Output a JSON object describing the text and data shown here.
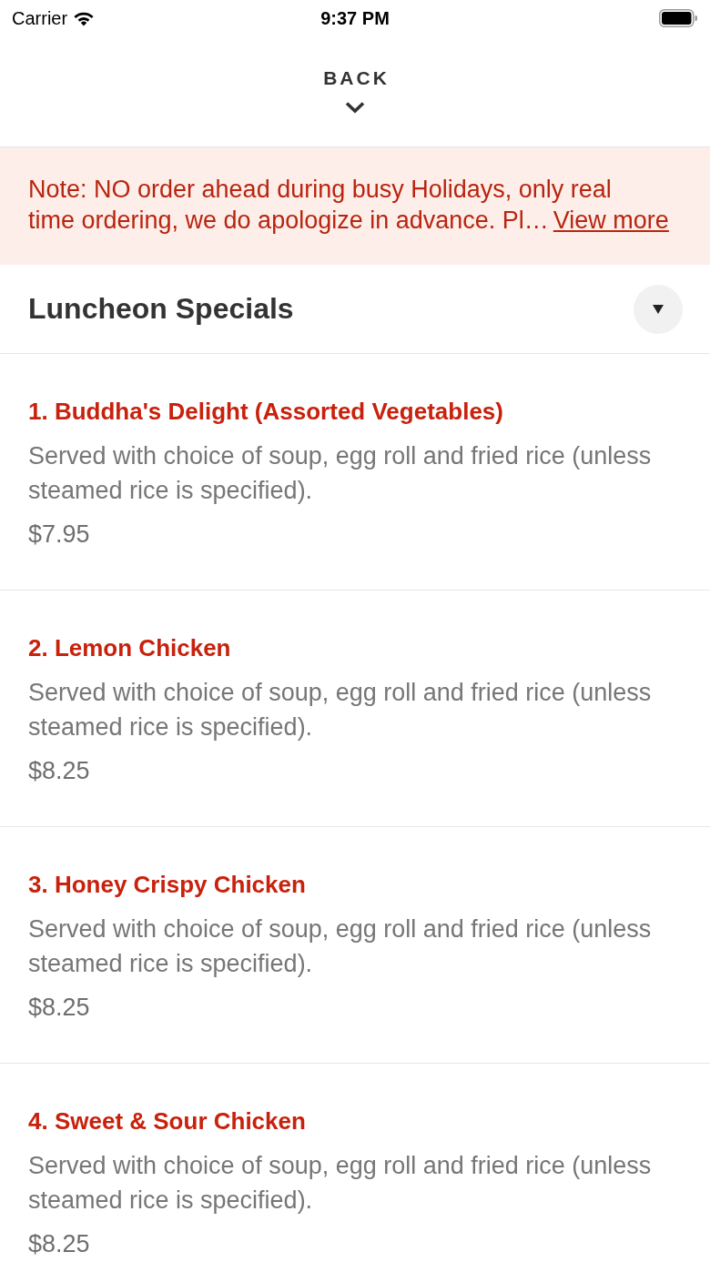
{
  "status_bar": {
    "carrier": "Carrier",
    "time": "9:37 PM"
  },
  "back_button": {
    "label": "BACK"
  },
  "notice": {
    "text": "Note: NO order ahead during busy Holidays, only real time ordering, we do apologize in advance. Pl…",
    "link": "View more"
  },
  "section": {
    "title": "Luncheon Specials"
  },
  "items": [
    {
      "name": "1. Buddha's Delight (Assorted Vegetables)",
      "description": "Served with choice of soup, egg roll and fried rice (unless steamed rice is specified).",
      "price": "$7.95"
    },
    {
      "name": "2. Lemon Chicken",
      "description": "Served with choice of soup, egg roll and fried rice (unless steamed rice is specified).",
      "price": "$8.25"
    },
    {
      "name": "3. Honey Crispy Chicken",
      "description": "Served with choice of soup, egg roll and fried rice (unless steamed rice is specified).",
      "price": "$8.25"
    },
    {
      "name": "4. Sweet & Sour Chicken",
      "description": "Served with choice of soup, egg roll and fried rice (unless steamed rice is specified).",
      "price": "$8.25"
    }
  ]
}
